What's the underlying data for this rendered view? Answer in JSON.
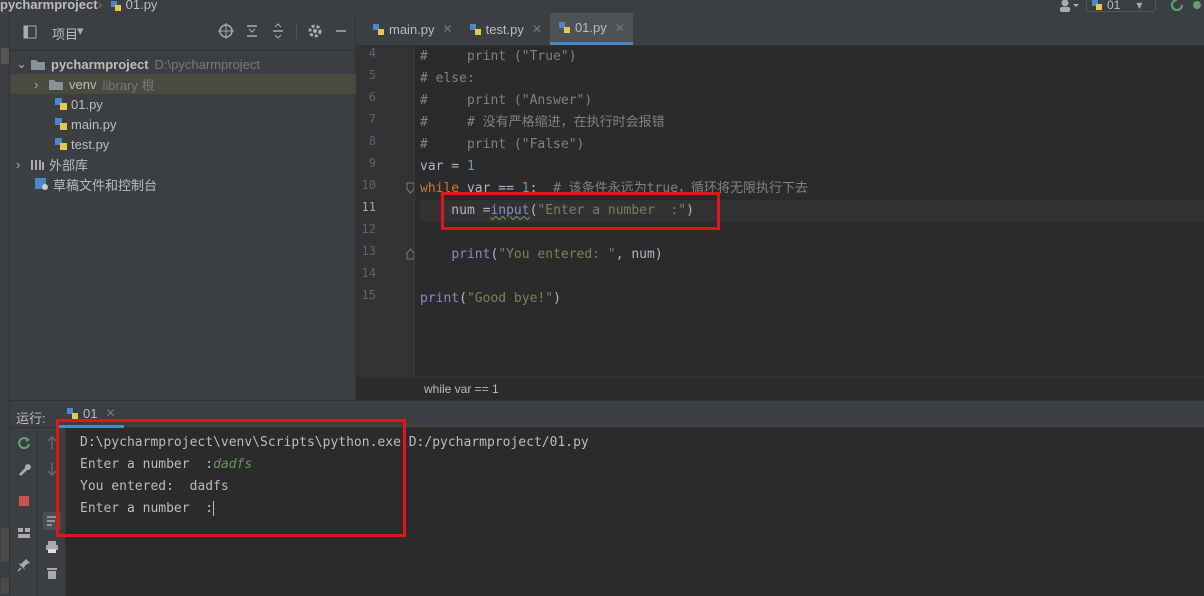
{
  "window": {
    "project_crumb": "pycharmproject",
    "file_crumb": "01.py",
    "run_config": "01"
  },
  "project": {
    "header_label": "项目",
    "root": {
      "name": "pycharmproject",
      "path": "D:\\pycharmproject"
    },
    "venv": {
      "name": "venv",
      "hint": "library 根"
    },
    "files": [
      "01.py",
      "main.py",
      "test.py"
    ],
    "external_libs": "外部库",
    "scratches": "草稿文件和控制台"
  },
  "editor": {
    "tabs": [
      {
        "label": "main.py"
      },
      {
        "label": "test.py"
      },
      {
        "label": "01.py"
      }
    ],
    "line_numbers": [
      "4",
      "5",
      "6",
      "7",
      "8",
      "9",
      "10",
      "11",
      "12",
      "13",
      "14",
      "15"
    ],
    "lines": {
      "l4": {
        "hash": "#",
        "rest": "     print (\"True\")"
      },
      "l5": "# else:",
      "l6": {
        "hash": "#",
        "rest": "     print (\"Answer\")"
      },
      "l7": {
        "hash": "#",
        "rest": "     # 没有严格缩进，在执行时会报错"
      },
      "l8": {
        "hash": "#",
        "rest": "     print (\"False\")"
      },
      "l9": {
        "var": "var = ",
        "num": "1"
      },
      "l10": {
        "kw": "while",
        "mid": " var == ",
        "num": "1",
        "colon": ":  ",
        "comment": "# 该条件永远为true，循环将无限执行下去"
      },
      "l11": {
        "pre": "    num =",
        "fn": "input",
        "open": "(",
        "str": "\"Enter a number  :\"",
        "close": ")"
      },
      "l13": {
        "pre": "    ",
        "fn": "print",
        "open": "(",
        "str": "\"You entered: \"",
        "rest": ", num)"
      },
      "l15": {
        "fn": "print",
        "open": "(",
        "str": "\"Good bye!\"",
        "close": ")"
      }
    },
    "breadcrumb": "while var == 1"
  },
  "run": {
    "label": "运行:",
    "tab": "01",
    "console": {
      "cmd": "D:\\pycharmproject\\venv\\Scripts\\python.exe D:/pycharmproject/01.py",
      "prompt1": "Enter a number  :",
      "input1": "dadfs",
      "output1": "You entered:  dadfs",
      "prompt2": "Enter a number  :"
    }
  },
  "colors": {
    "highlight_box": "#e0161b",
    "accent": "#4a88c7"
  }
}
